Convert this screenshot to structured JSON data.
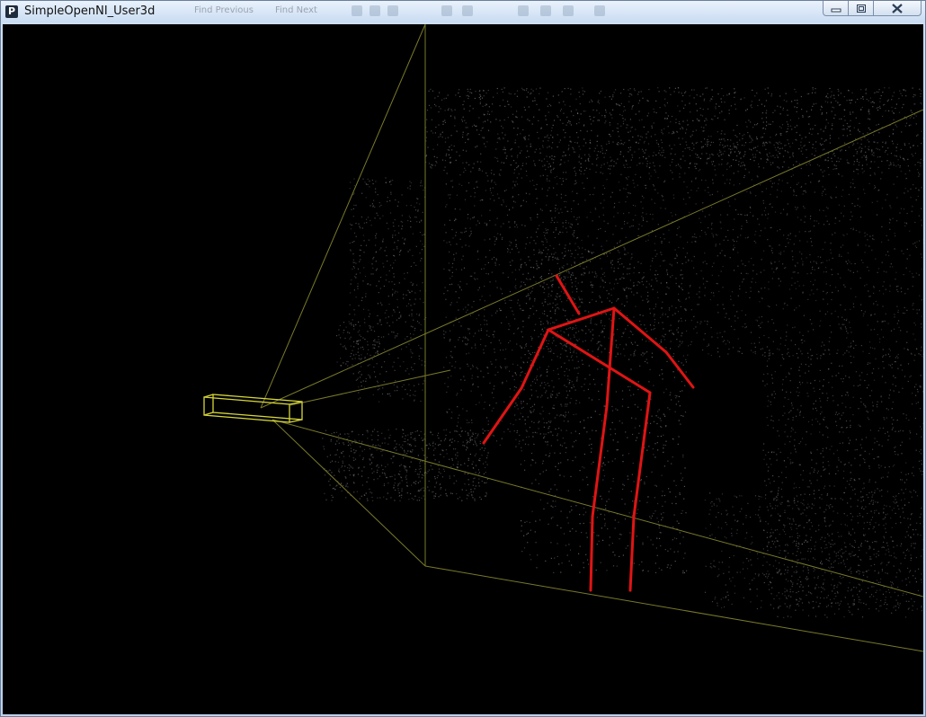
{
  "window": {
    "title": "SimpleOpenNI_User3d",
    "app_icon_letter": "P",
    "icon_name": "processing-app-icon"
  },
  "ghost_toolbar": {
    "find_previous": "Find Previous",
    "find_next": "Find Next"
  },
  "controls": {
    "minimize_icon": "minimize-icon",
    "maximize_icon": "maximize-icon",
    "close_icon": "close-icon"
  },
  "colors": {
    "frustum": "#7a7a2a",
    "camera": "#d6d63a",
    "skeleton": "#e01414",
    "points": "#9a9a9a",
    "background": "#000000"
  }
}
